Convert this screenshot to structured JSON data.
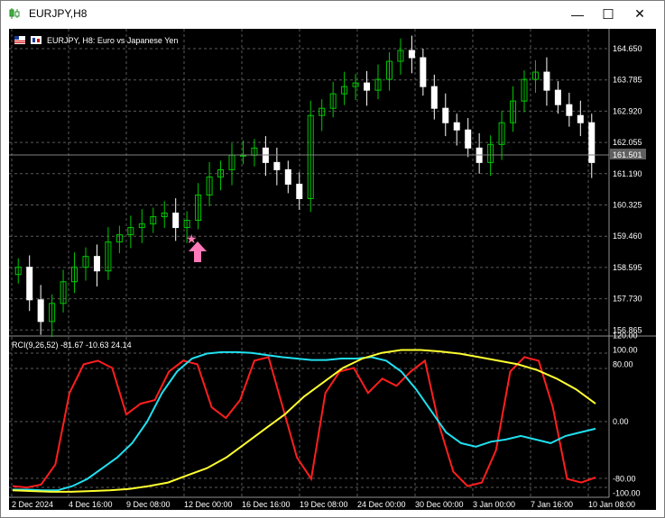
{
  "window": {
    "title": "EURJPY,H8",
    "minimize_glyph": "—",
    "maximize_glyph": "☐",
    "close_glyph": "✕"
  },
  "colors": {
    "background": "#000000",
    "grid": "#5a5a5a",
    "bull_candle": "#00c800",
    "bear_candle": "#ffffff",
    "rci_short": "#ff1e1e",
    "rci_mid": "#20e0f0",
    "rci_long": "#ffff30",
    "arrow_marker": "#ff7ab8",
    "price_tag_bg": "#606060"
  },
  "chart": {
    "header": "EURJPY, H8:  Euro vs Japanese Yen",
    "price_axis": [
      "164.650",
      "163.785",
      "162.920",
      "162.055",
      "161.190",
      "160.325",
      "159.460",
      "158.595",
      "157.730",
      "156.865"
    ],
    "current_price": "161.501",
    "time_axis": [
      "2 Dec 2024",
      "4 Dec 16:00",
      "9 Dec 08:00",
      "12 Dec 00:00",
      "16 Dec 16:00",
      "19 Dec 08:00",
      "24 Dec 00:00",
      "30 Dec 00:00",
      "3 Jan 00:00",
      "7 Jan 16:00",
      "10 Jan 08:00"
    ]
  },
  "indicator": {
    "label": "RCI(9,26,52) -81.67 -10.63 24.14",
    "axis": [
      "120.00",
      "100.00",
      "80.00",
      "0.00",
      "-80.00",
      "-100.00"
    ]
  },
  "chart_data": {
    "type": "line",
    "title": "EURJPY, H8: Euro vs Japanese Yen",
    "xlabel": "",
    "ylabel": "",
    "price_panel": {
      "ylim": [
        156.2,
        165.2
      ],
      "approx_closes": [
        158.6,
        157.7,
        157.1,
        157.6,
        158.2,
        158.6,
        158.9,
        158.5,
        159.3,
        159.5,
        159.7,
        159.8,
        160.0,
        160.1,
        159.7,
        159.9,
        160.6,
        161.1,
        161.3,
        161.7,
        161.7,
        161.9,
        161.5,
        161.3,
        160.9,
        160.5,
        162.8,
        163.0,
        163.4,
        163.6,
        163.7,
        163.5,
        163.8,
        164.3,
        164.6,
        164.4,
        163.6,
        163.0,
        162.6,
        162.4,
        161.9,
        161.5,
        162.0,
        162.6,
        163.2,
        163.8,
        164.0,
        163.5,
        163.1,
        162.8,
        162.6,
        161.5
      ]
    },
    "rci_panel": {
      "ylim": [
        -100,
        120
      ],
      "series": [
        {
          "name": "RCI 9",
          "values": [
            -90,
            -92,
            -88,
            -60,
            40,
            80,
            85,
            75,
            10,
            25,
            30,
            70,
            85,
            80,
            20,
            5,
            30,
            85,
            90,
            20,
            -50,
            -80,
            40,
            70,
            75,
            40,
            60,
            50,
            70,
            85,
            -5,
            -70,
            -90,
            -85,
            -40,
            70,
            90,
            85,
            20,
            -80,
            -85,
            -78
          ]
        },
        {
          "name": "RCI 26",
          "values": [
            -95,
            -95,
            -96,
            -96,
            -90,
            -80,
            -65,
            -50,
            -30,
            0,
            40,
            70,
            88,
            95,
            97,
            97,
            96,
            93,
            90,
            88,
            86,
            86,
            88,
            88,
            90,
            85,
            70,
            45,
            15,
            -15,
            -30,
            -35,
            -28,
            -25,
            -20,
            -25,
            -30,
            -20,
            -15,
            -10
          ]
        },
        {
          "name": "RCI 52",
          "values": [
            -96,
            -97,
            -98,
            -98,
            -97,
            -96,
            -94,
            -90,
            -85,
            -75,
            -65,
            -50,
            -30,
            -10,
            10,
            35,
            55,
            75,
            88,
            96,
            100,
            100,
            98,
            95,
            90,
            85,
            80,
            72,
            60,
            45,
            25
          ]
        }
      ]
    }
  }
}
